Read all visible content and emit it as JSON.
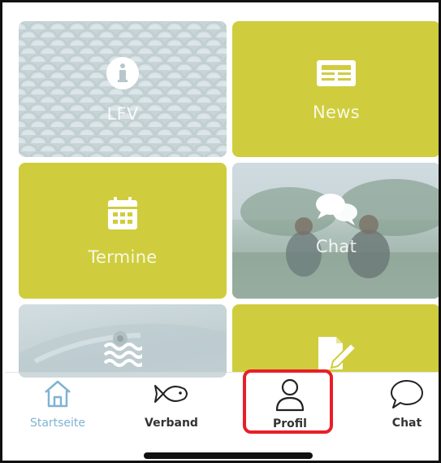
{
  "tiles": [
    {
      "id": "lfv",
      "label": "LFV",
      "icon": "info-circle-icon",
      "style": "photo-scales"
    },
    {
      "id": "news",
      "label": "News",
      "icon": "newspaper-icon",
      "style": "yellow"
    },
    {
      "id": "termine",
      "label": "Termine",
      "icon": "calendar-icon",
      "style": "yellow"
    },
    {
      "id": "chat",
      "label": "Chat",
      "icon": "chat-bubbles-icon",
      "style": "photo-lake"
    },
    {
      "id": "gewaesser",
      "label": "",
      "icon": "waves-icon",
      "style": "photo-pike"
    },
    {
      "id": "formular",
      "label": "",
      "icon": "edit-document-icon",
      "style": "yellow"
    }
  ],
  "tabbar": {
    "items": [
      {
        "label": "Startseite",
        "icon": "home-icon",
        "active": true
      },
      {
        "label": "Verband",
        "icon": "fish-icon",
        "active": false
      },
      {
        "label": "Profil",
        "icon": "user-icon",
        "active": false,
        "highlighted": true
      },
      {
        "label": "Chat",
        "icon": "chat-bubble-icon",
        "active": false
      }
    ]
  },
  "colors": {
    "tile_yellow": "#cfcd3e",
    "active_tab": "#7fb3d3",
    "highlight_border": "#e81f28"
  }
}
